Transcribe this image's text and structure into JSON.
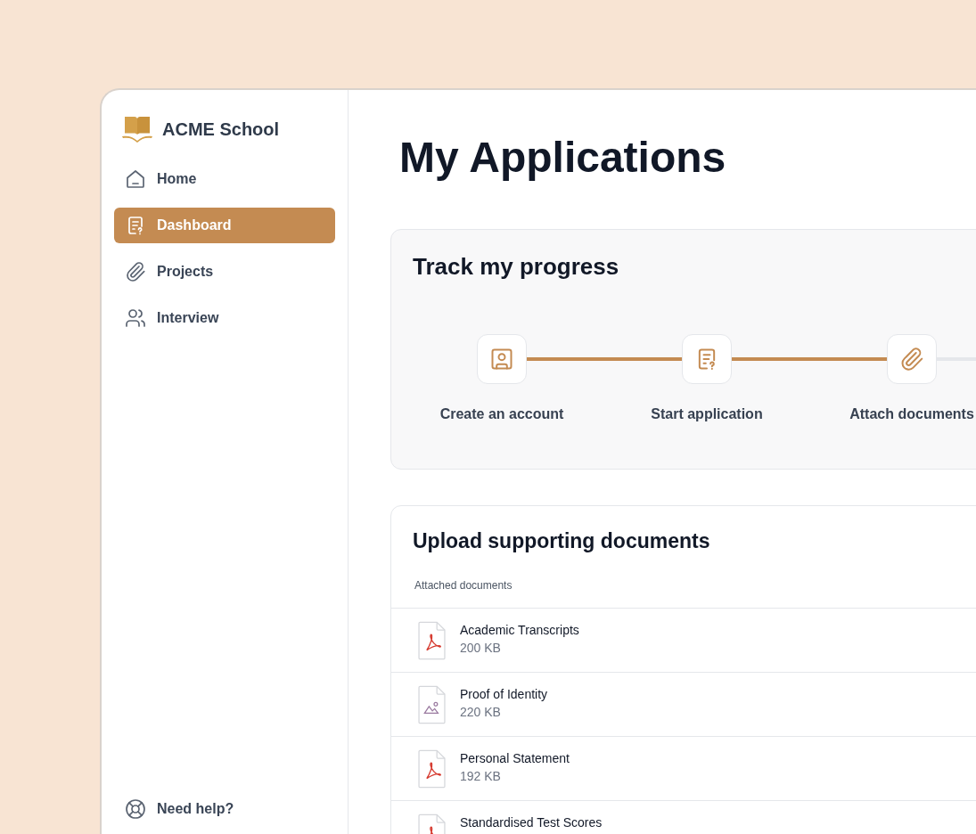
{
  "sidebar": {
    "brand": "ACME School",
    "items": [
      {
        "label": "Home",
        "kind": "home",
        "selected": false
      },
      {
        "label": "Dashboard",
        "kind": "form",
        "selected": true
      },
      {
        "label": "Projects",
        "kind": "clip",
        "selected": false
      },
      {
        "label": "Interview",
        "kind": "people",
        "selected": false
      }
    ],
    "help": "Need help?"
  },
  "page_title": "My Applications",
  "progress": {
    "title": "Track my progress",
    "steps": [
      {
        "label": "Create an account",
        "kind": "account",
        "line_done": true
      },
      {
        "label": "Start application",
        "kind": "form",
        "line_done": true
      },
      {
        "label": "Attach documents",
        "kind": "clip",
        "line_done": false
      }
    ]
  },
  "uploads": {
    "title": "Upload supporting documents",
    "column_header": "Attached documents",
    "files": [
      {
        "name": "Academic Transcripts",
        "size": "200 KB",
        "kind": "pdf"
      },
      {
        "name": "Proof of Identity",
        "size": "220 KB",
        "kind": "image"
      },
      {
        "name": "Personal Statement",
        "size": "192 KB",
        "kind": "pdf"
      },
      {
        "name": "Standardised Test Scores",
        "kind": "pdf"
      }
    ]
  }
}
